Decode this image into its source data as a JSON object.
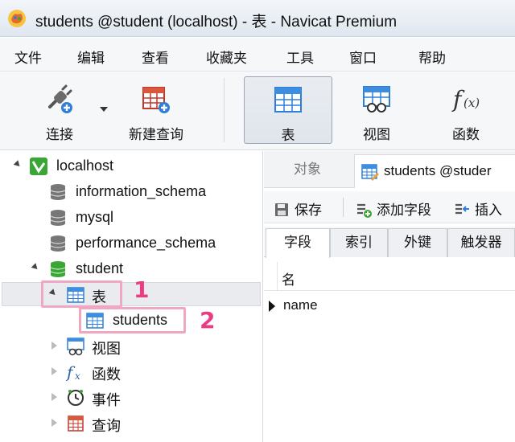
{
  "window": {
    "title": "students @student (localhost) - 表 - Navicat Premium"
  },
  "menu": [
    "文件",
    "编辑",
    "查看",
    "收藏夹",
    "工具",
    "窗口",
    "帮助"
  ],
  "toolbar": {
    "connect": "连接",
    "new_query": "新建查询",
    "table": "表",
    "view": "视图",
    "function": "函数"
  },
  "tree": {
    "connection": "localhost",
    "databases": [
      "information_schema",
      "mysql",
      "performance_schema"
    ],
    "active_db": "student",
    "tables_node": "表",
    "table_item": "students",
    "views_node": "视图",
    "functions_node": "函数",
    "events_node": "事件",
    "queries_node": "查询"
  },
  "callouts": [
    "1",
    "2"
  ],
  "tabs": {
    "objects": "对象",
    "students_tab": "students @studer"
  },
  "subtoolbar": {
    "save": "保存",
    "add_field": "添加字段",
    "insert": "插入"
  },
  "design_tabs": [
    "字段",
    "索引",
    "外键",
    "触发器"
  ],
  "grid": {
    "header_name": "名",
    "rows": [
      "name"
    ]
  },
  "colors": {
    "highlight_box": "#f0a8c2",
    "callout": "#e93d83",
    "db_green": "#3aa635"
  }
}
